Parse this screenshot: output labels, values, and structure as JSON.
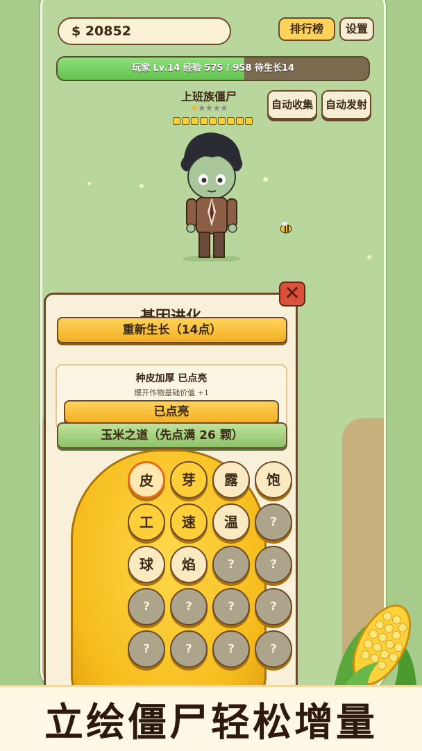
{
  "header": {
    "money": "$ 20852",
    "leaderboard_label": "排行榜",
    "settings_label": "设置"
  },
  "xp_bar": {
    "text": "玩家 Lv.14  经验 575 / 958  待生长14",
    "progress": 0.6
  },
  "auto_buttons": {
    "collect_label": "自动收集",
    "fire_label": "自动发射"
  },
  "zombie": {
    "name": "上班族僵尸",
    "stars_total": 5,
    "stars_filled": 1,
    "level_dots": 9
  },
  "panel": {
    "title": "基因进化",
    "regrow_label": "重新生长（14点）",
    "skill": {
      "name": "种皮加厚   已点亮",
      "desc": "爆开作物基础价值 +1",
      "button_label": "已点亮"
    },
    "corn_path_label": "玉米之道（先点满 26 颗）"
  },
  "gene_grid": [
    [
      "皮",
      "芽",
      "露",
      "饱"
    ],
    [
      "工",
      "速",
      "温",
      "?"
    ],
    [
      "球",
      "焰",
      "?",
      "?"
    ],
    [
      "?",
      "?",
      "?",
      "?"
    ],
    [
      "?",
      "?",
      "?",
      "?"
    ]
  ],
  "gene_states": [
    [
      "selected",
      "lit",
      "cream",
      "cream"
    ],
    [
      "lit",
      "lit",
      "cream",
      "locked"
    ],
    [
      "cream",
      "cream",
      "locked",
      "locked"
    ],
    [
      "locked",
      "locked",
      "locked",
      "locked"
    ],
    [
      "locked",
      "locked",
      "locked",
      "locked"
    ]
  ],
  "caption": "立绘僵尸轻松增量",
  "colors": {
    "accent_yellow": "#f2b023",
    "xp_green": "#62c34e",
    "close_red": "#d9513a",
    "background_green": "#a6cb8a"
  }
}
